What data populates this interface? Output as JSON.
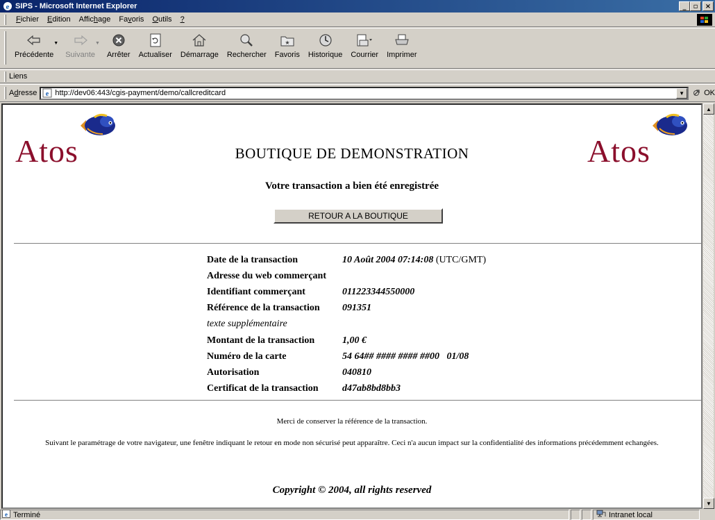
{
  "window": {
    "title": "SIPS - Microsoft Internet Explorer",
    "minimize": "_",
    "maximize": "▫",
    "close": "×"
  },
  "menu": {
    "items": [
      {
        "pre": "",
        "u": "F",
        "post": "ichier"
      },
      {
        "pre": "",
        "u": "E",
        "post": "dition"
      },
      {
        "pre": "Affic",
        "u": "h",
        "post": "age"
      },
      {
        "pre": "Fa",
        "u": "v",
        "post": "oris"
      },
      {
        "pre": "",
        "u": "O",
        "post": "utils"
      },
      {
        "pre": "",
        "u": "?",
        "post": ""
      }
    ]
  },
  "toolbar": {
    "back": "Précédente",
    "forward": "Suivante",
    "stop": "Arrêter",
    "refresh": "Actualiser",
    "home": "Démarrage",
    "search": "Rechercher",
    "favorites": "Favoris",
    "history": "Historique",
    "mail": "Courrier",
    "print": "Imprimer"
  },
  "links": {
    "label": "Liens"
  },
  "address": {
    "label_pre": "A",
    "label_u": "d",
    "label_post": "resse",
    "url": "http://dev06:443/cgis-payment/demo/callcreditcard",
    "go": "OK"
  },
  "page": {
    "logo_text": "Atos",
    "title": "BOUTIQUE DE DEMONSTRATION",
    "confirmation": "Votre transaction a bien été enregistrée",
    "return_button": "RETOUR A LA BOUTIQUE",
    "details": {
      "date_label": "Date de la transaction",
      "date_value": "10 Août 2004 07:14:08",
      "date_suffix": "(UTC/GMT)",
      "web_label": "Adresse du web commerçant",
      "merchant_id_label": "Identifiant commerçant",
      "merchant_id_value": "011223344550000",
      "reference_label": "Référence de la transaction",
      "reference_value": "091351",
      "extra_label": "texte supplémentaire",
      "amount_label": "Montant de la transaction",
      "amount_value": "1,00 €",
      "card_label": "Numéro de la carte",
      "card_value": "54 64## #### #### ##00   01/08",
      "auth_label": "Autorisation",
      "auth_value": "040810",
      "cert_label": "Certificat de la transaction",
      "cert_value": "d47ab8bd8bb3"
    },
    "note_keep_reference": "Merci de conserver la référence de la transaction.",
    "note_browser": "Suivant le paramétrage de votre navigateur, une fenêtre indiquant le retour en mode non sécurisé peut apparaître. Ceci n'a aucun impact sur la confidentialité des informations précédemment echangées.",
    "copyright": "Copyright © 2004, all rights reserved"
  },
  "status": {
    "text": "Terminé",
    "zone": "Intranet local"
  }
}
